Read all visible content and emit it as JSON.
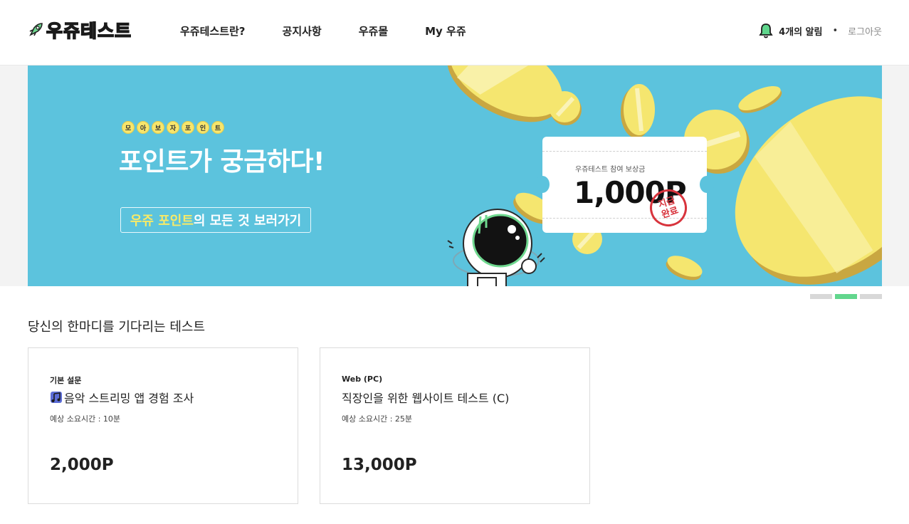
{
  "header": {
    "logo_text": "우쥬테스트",
    "nav": [
      {
        "label": "우쥬테스트란?"
      },
      {
        "label": "공지사항"
      },
      {
        "label": "우쥬몰"
      },
      {
        "label": "My 우쥬"
      }
    ],
    "alarm_label": "4개의 알림",
    "separator": "•",
    "logout_label": "로그아웃"
  },
  "banner": {
    "dots": [
      "모",
      "아",
      "보",
      "자",
      "포",
      "인",
      "트"
    ],
    "title": "포인트가 궁금하다!",
    "button": {
      "highlight": "우쥬 포인트",
      "rest": "의 모든 것 보러가기"
    },
    "ticket_label": "우쥬테스트 참여 보상금",
    "ticket_amount": "1,000P",
    "stamp_text_1": "지급",
    "stamp_text_2": "완료",
    "background_color": "#5cc3dd",
    "coin_color": "#f5e66f"
  },
  "pager": {
    "count": 3,
    "active_index": 1,
    "active_color": "#62d68d"
  },
  "section": {
    "title": "당신의 한마디를 기다리는 테스트",
    "cards": [
      {
        "category": "기본 설문",
        "icon": "music-note-icon",
        "title": "음악 스트리밍 앱 경험 조사",
        "time": "예상 소요시간 : 10분",
        "point": "2,000P"
      },
      {
        "category": "Web (PC)",
        "icon": "",
        "title": "직장인을 위한 웹사이트 테스트 (C)",
        "time": "예상 소요시간 : 25분",
        "point": "13,000P"
      }
    ]
  }
}
